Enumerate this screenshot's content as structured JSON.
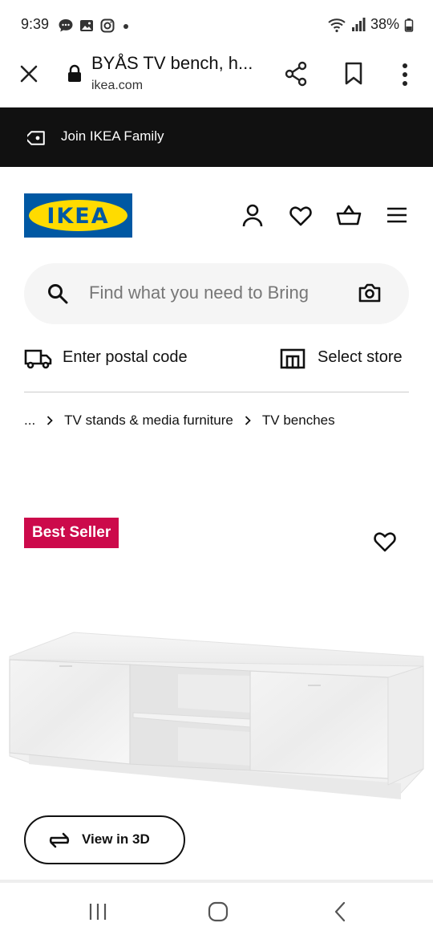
{
  "status_bar": {
    "time": "9:39",
    "battery": "38%",
    "icons": [
      "chat-icon",
      "gallery-icon",
      "instagram-icon",
      "dot-icon",
      "wifi-icon",
      "signal-icon",
      "battery-icon"
    ]
  },
  "browser": {
    "title": "BYÅS TV bench, h...",
    "domain": "ikea.com"
  },
  "family_banner": {
    "label": "Join IKEA Family"
  },
  "header": {
    "logo_text": "IKEA",
    "icons": [
      "account-icon",
      "heart-icon",
      "basket-icon",
      "menu-icon"
    ]
  },
  "search": {
    "placeholder": "Find what you need to Bring"
  },
  "location": {
    "postal_label": "Enter postal code",
    "store_label": "Select store"
  },
  "breadcrumb": {
    "items": [
      "...",
      "TV stands & media furniture",
      "TV benches"
    ]
  },
  "product": {
    "badge": "Best Seller",
    "view3d_label": "View in 3D"
  },
  "colors": {
    "ikea_blue": "#0058a3",
    "ikea_yellow": "#ffdb00",
    "badge_red": "#cc0a4b",
    "banner_black": "#111111"
  }
}
